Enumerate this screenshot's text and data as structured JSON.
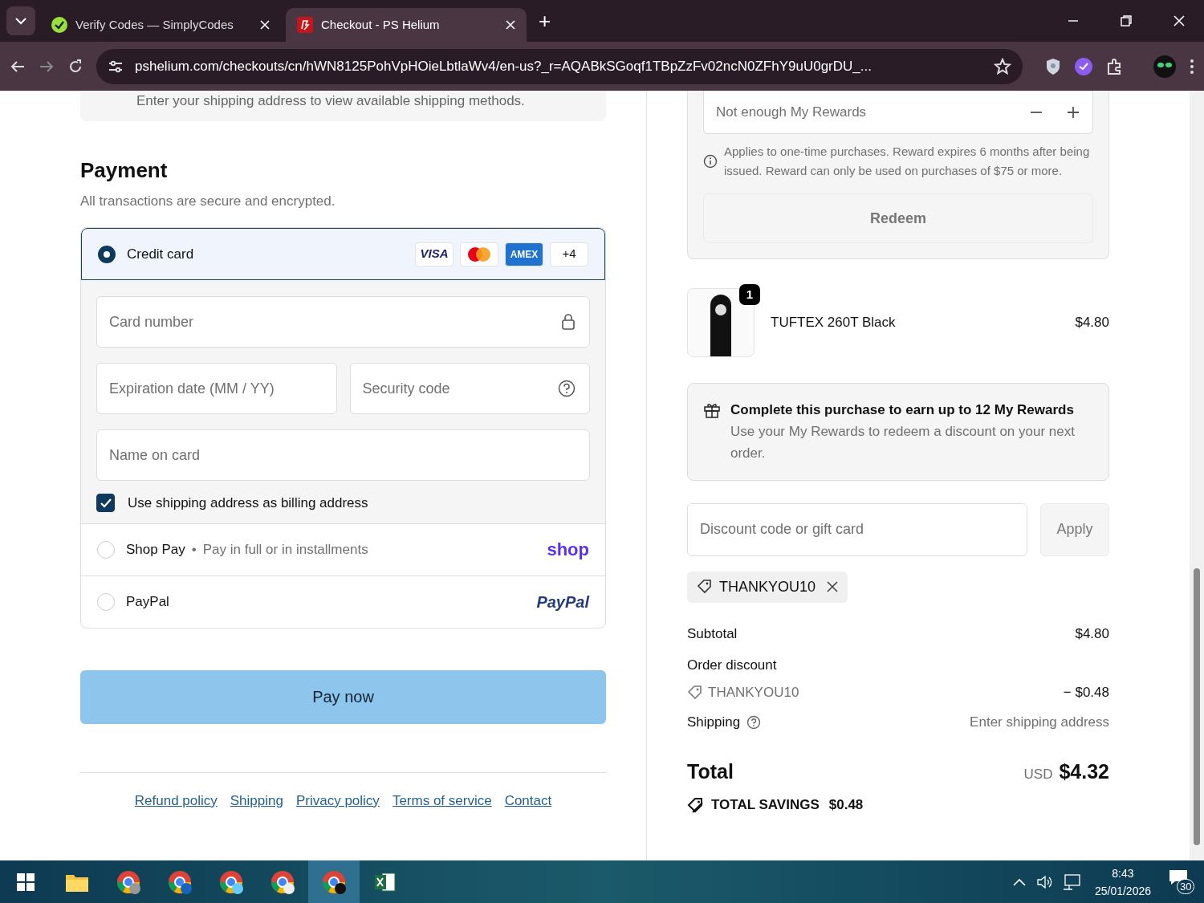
{
  "browser": {
    "tabs": [
      {
        "title": "Verify Codes — SimplyCodes",
        "selected": false
      },
      {
        "title": "Checkout - PS Helium",
        "selected": true
      }
    ],
    "new_tab": "+",
    "url": "pshelium.com/checkouts/cn/hWN8125PohVpHOieLbtlaWv4/en-us?_r=AQABkSGoqf1TBpZzFv02ncN0ZFhY9uU0grDU_..."
  },
  "shipping_note": "Enter your shipping address to view available shipping methods.",
  "payment": {
    "title": "Payment",
    "subtitle": "All transactions are secure and encrypted.",
    "methods": [
      {
        "kind": "card",
        "label": "Credit card",
        "selected": true,
        "brands": [
          "VISA",
          "AMEX"
        ],
        "more": "+4"
      },
      {
        "kind": "shoppay",
        "label": "Shop Pay",
        "separator": "•",
        "detail": "Pay in full or in installments",
        "logo": "shop",
        "selected": false
      },
      {
        "kind": "paypal",
        "label": "PayPal",
        "logo": "PayPal",
        "selected": false
      }
    ],
    "fields": {
      "card_number": {
        "placeholder": "Card number"
      },
      "expiry": {
        "placeholder": "Expiration date (MM / YY)"
      },
      "security": {
        "placeholder": "Security code"
      },
      "name": {
        "placeholder": "Name on card"
      }
    },
    "billing": {
      "label": "Use shipping address as billing address",
      "checked": true
    }
  },
  "pay_button": "Pay now",
  "footer_links": [
    "Refund policy",
    "Shipping",
    "Privacy policy",
    "Terms of service",
    "Contact"
  ],
  "rewards": {
    "field": "Not enough My Rewards",
    "note": "Applies to one-time purchases. Reward expires 6 months after being issued. Reward can only be used on purchases of $75 or more.",
    "redeem": "Redeem"
  },
  "product": {
    "name": "TUFTEX 260T Black",
    "price": "$4.80",
    "quantity": "1"
  },
  "promo": {
    "title": "Complete this purchase to earn up to 12 My Rewards",
    "text": "Use your My Rewards to redeem a discount on your next order."
  },
  "discount": {
    "placeholder": "Discount code or gift card",
    "apply": "Apply",
    "applied_code": "THANKYOU10"
  },
  "summary": {
    "subtotal_label": "Subtotal",
    "subtotal": "$4.80",
    "discount_label": "Order discount",
    "discount_code": "THANKYOU10",
    "discount": "− $0.48",
    "shipping_label": "Shipping",
    "shipping": "Enter shipping address",
    "total_label": "Total",
    "currency": "USD",
    "total": "$4.32",
    "savings_label": "TOTAL SAVINGS",
    "savings": "$0.48"
  },
  "taskbar": {
    "time": "8:43",
    "date": "25/01/2026",
    "notifications": "30"
  }
}
